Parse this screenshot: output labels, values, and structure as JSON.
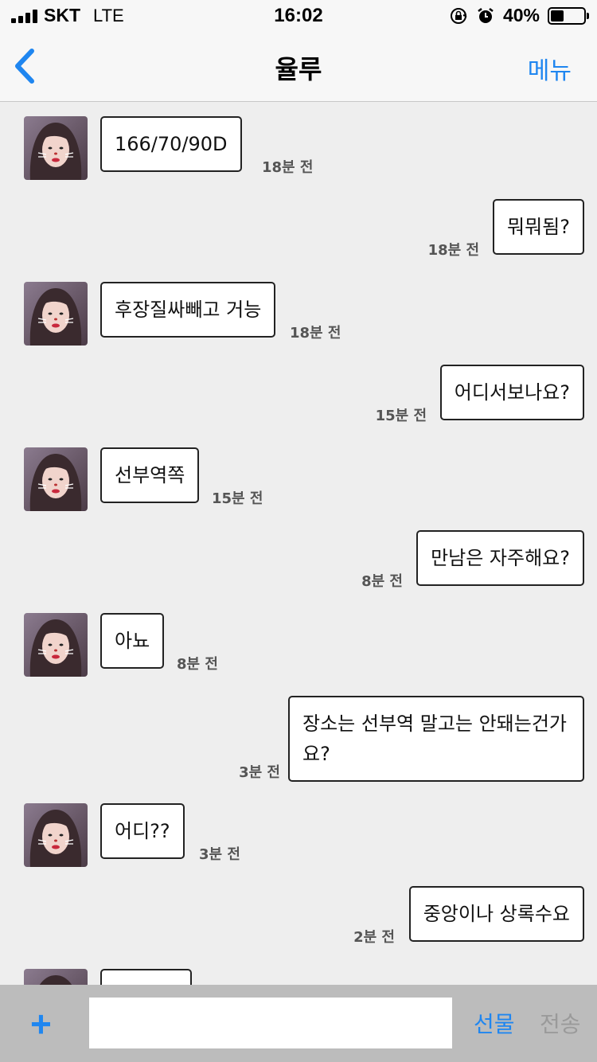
{
  "status_bar": {
    "carrier": "SKT",
    "network": "LTE",
    "time": "16:02",
    "battery": "40%",
    "battery_level": 0.4
  },
  "nav": {
    "title": "율루",
    "menu_label": "메뉴"
  },
  "messages": [
    {
      "side": "left",
      "text": "166/70/90D",
      "time": "18분 전"
    },
    {
      "side": "right",
      "text": "뭐뭐됨?",
      "time": "18분 전"
    },
    {
      "side": "left",
      "text": "후장질싸빼고 거능",
      "time": "18분 전"
    },
    {
      "side": "right",
      "text": "어디서보나요?",
      "time": "15분 전"
    },
    {
      "side": "left",
      "text": "선부역쪽",
      "time": "15분 전"
    },
    {
      "side": "right",
      "text": "만남은 자주해요?",
      "time": "8분 전"
    },
    {
      "side": "left",
      "text": "아뇨",
      "time": "8분 전"
    },
    {
      "side": "right",
      "text": "장소는 선부역 말고는 안돼는건가요?",
      "time": "3분 전"
    },
    {
      "side": "left",
      "text": "어디??",
      "time": "3분 전"
    },
    {
      "side": "right",
      "text": "중앙이나 상록수요",
      "time": "2분 전"
    },
    {
      "side": "left",
      "text": "",
      "time": ""
    }
  ],
  "input_bar": {
    "plus_label": "+",
    "input_value": "",
    "gift_label": "선물",
    "send_label": "전송"
  },
  "colors": {
    "accent": "#1f86f0",
    "background": "#eeeeee",
    "bar": "#f7f7f7"
  },
  "icons": {
    "back": "chevron-left-icon",
    "orientation_lock": "orientation-lock-icon",
    "alarm": "alarm-icon"
  }
}
